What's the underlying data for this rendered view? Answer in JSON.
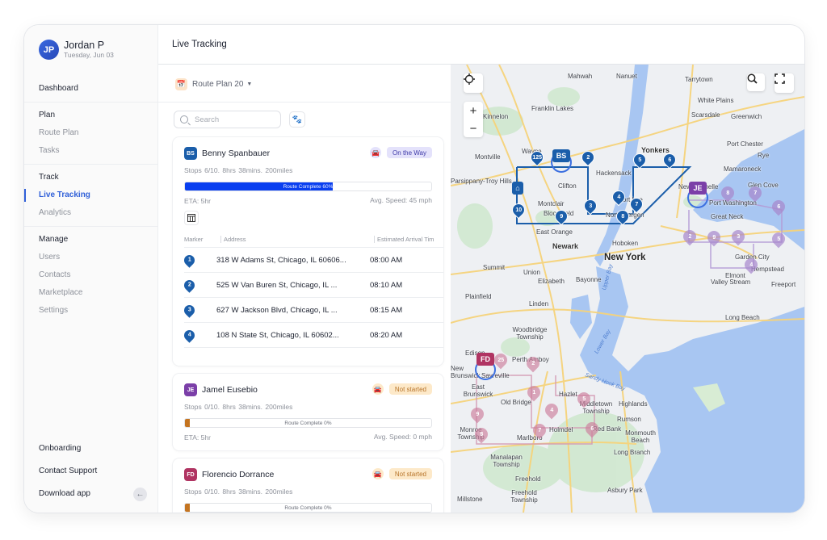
{
  "user": {
    "initials": "JP",
    "name": "Jordan P",
    "date": "Tuesday, Jun 03"
  },
  "sidebar": {
    "dashboard": "Dashboard",
    "plan": {
      "title": "Plan",
      "items": [
        "Route Plan",
        "Tasks"
      ]
    },
    "track": {
      "title": "Track",
      "items": [
        "Live Tracking",
        "Analytics"
      ],
      "active": "Live Tracking"
    },
    "manage": {
      "title": "Manage",
      "items": [
        "Users",
        "Contacts",
        "Marketplace",
        "Settings"
      ]
    },
    "bottom": [
      "Onboarding",
      "Contact Support",
      "Download app"
    ],
    "collapse_icon": "arrow-left-icon"
  },
  "header": {
    "title": "Live Tracking"
  },
  "panel": {
    "route_plan": "Route Plan 20",
    "search_placeholder": "Search",
    "drivers": [
      {
        "initials": "BS",
        "name": "Benny Spanbauer",
        "color": "#1b5eaa",
        "status": "On the Way",
        "status_bg": "#e4e2fb",
        "status_color": "#3e3aa8",
        "car_bg": "#e4e2fb",
        "car_color": "#3e3aa8",
        "stops": "Stops  6/10.  8hrs 38mins.  200miles",
        "progress": 60,
        "progress_label": "Route Complete 60%",
        "progress_color": "#0a3ff0",
        "eta": "ETA: 5hr",
        "speed": "Avg. Speed: 45 mph",
        "table": {
          "columns": [
            "Marker",
            "Address",
            "Estimated Arrival Tim"
          ],
          "rows": [
            {
              "marker": "1",
              "address": "318 W Adams St, Chicago, IL 60606...",
              "time": "08:00 AM"
            },
            {
              "marker": "2",
              "address": "525 W Van Buren St, Chicago, IL ...",
              "time": "08:10 AM"
            },
            {
              "marker": "3",
              "address": "627 W Jackson Blvd, Chicago, IL ...",
              "time": "08:15 AM"
            },
            {
              "marker": "4",
              "address": "108 N State St, Chicago, IL 60602...",
              "time": "08:20 AM"
            }
          ]
        }
      },
      {
        "initials": "JE",
        "name": "Jamel Eusebio",
        "color": "#7b3fa8",
        "status": "Not started",
        "status_bg": "#fde9c9",
        "status_color": "#b7742a",
        "car_bg": "#fde9c9",
        "car_color": "#c9822f",
        "stops": "Stops  0/10.  8hrs 38mins.  200miles",
        "progress": 0,
        "progress_label": "Route Complete 0%",
        "progress_color": "#c47420",
        "eta": "ETA: 5hr",
        "speed": "Avg. Speed: 0 mph"
      },
      {
        "initials": "FD",
        "name": "Florencio Dorrance",
        "color": "#b03462",
        "status": "Not started",
        "status_bg": "#fde9c9",
        "status_color": "#b7742a",
        "car_bg": "#fde9c9",
        "car_color": "#c9822f",
        "stops": "Stops  0/10.  8hrs 38mins.  200miles",
        "progress": 0,
        "progress_label": "Route Complete 0%",
        "progress_color": "#c47420"
      }
    ]
  },
  "map": {
    "controls": {
      "locate": "crosshair-icon",
      "zoom_in": "+",
      "zoom_out": "−",
      "search": "zoom-search-icon",
      "fullscreen": "fullscreen-icon"
    },
    "labels": {
      "mahwah": "Mahwah",
      "nanuet": "Nanuet",
      "tarrytown": "Tarrytown",
      "kinnelon": "Kinnelon",
      "franklin_lakes": "Franklin Lakes",
      "white_plains": "White Plains",
      "scarsdale": "Scarsdale",
      "port_chester": "Port Chester",
      "greenwich": "Greenwich",
      "rye": "Rye",
      "montville": "Montville",
      "wayne": "Wayne",
      "parsippany": "Parsippany-Troy Hills",
      "mamaroneck": "Mamaroneck",
      "yonkers": "Yonkers",
      "hackensack": "Hackensack",
      "new_rochelle": "New Rochelle",
      "clifton": "Clifton",
      "fort_lee": "Fort Lee",
      "glen_cove": "Glen Cove",
      "montclair": "Montclair",
      "bloomfield": "Bloomfield",
      "north_bergen": "North Bergen",
      "port_washington": "Port Washington",
      "great_neck": "Great Neck",
      "east_orange": "East Orange",
      "newark": "Newark",
      "hoboken": "Hoboken",
      "new_york": "New York",
      "summit": "Summit",
      "union": "Union",
      "garden_city": "Garden City",
      "hempstead": "Hempstead",
      "elmont": "Elmont",
      "elizabeth": "Elizabeth",
      "bayonne": "Bayonne",
      "valley_stream": "Valley Stream",
      "freeport": "Freeport",
      "plainfield": "Plainfield",
      "linden": "Linden",
      "long_beach": "Long Beach",
      "woodbridge": "Woodbridge Township",
      "edison": "Edison",
      "perth_amboy": "Perth Amboy",
      "new_brunswick": "New Brunswick",
      "sayreville": "Sayreville",
      "east_brunswick": "East Brunswick",
      "old_bridge": "Old Bridge",
      "hazlet": "Hazlet",
      "middletown": "Middletown Township",
      "highlands": "Highlands",
      "rumson": "Rumson",
      "monroe": "Monroe Township",
      "marlboro": "Marlboro",
      "holmdel": "Holmdel",
      "red_bank": "Red Bank",
      "monmouth_beach": "Monmouth Beach",
      "long_branch": "Long Branch",
      "manalapan": "Manalapan Township",
      "freehold": "Freehold",
      "freehold_twp": "Freehold Township",
      "asbury_park": "Asbury Park",
      "millstone": "Millstone",
      "upper_bay": "Upper Bay",
      "lower_bay": "Lower Bay",
      "sandy_hook_bay": "Sandy Hook Bay"
    },
    "driver_tags": {
      "bs": "BS",
      "je": "JE",
      "fd": "FD"
    },
    "bs_markers": [
      "125",
      "2",
      "3",
      "4",
      "5",
      "6",
      "7",
      "8",
      "9",
      "10"
    ],
    "je_markers": [
      "2",
      "3",
      "4",
      "5",
      "6",
      "7",
      "8",
      "9"
    ],
    "fd_markers": [
      "25",
      "2",
      "1",
      "4",
      "5",
      "6",
      "7",
      "8",
      "9"
    ]
  }
}
